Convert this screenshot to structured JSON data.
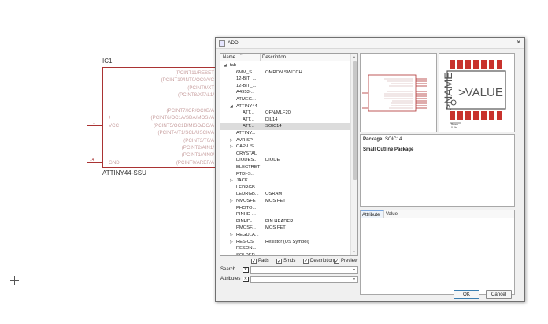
{
  "schematic": {
    "part_name": "IC1",
    "part_value": "ATTINY44-SSU",
    "pin_labels": [
      "(PCINT11/RESET",
      "(PCINT10/INT0/OC0A/C",
      "(PCINT9/XT",
      "(PCINT8/XTAL1/",
      "(PCINT7/ICP/OC0B/A",
      "(PCINT6/OC1A/SDA/MOSI/A",
      "(PCINT5/OC1B/MISO/DO/A",
      "(PCINT4/T1/SCL/USCK/A",
      "(PCINT3/T0/A",
      "(PCINT2/AIN1/",
      "(PCINT1/AIN0/",
      "(PCINT0/AREF/A"
    ],
    "vcc_pin_num": "1",
    "vcc_label": "VCC",
    "gnd_pin_num": "14",
    "gnd_label": "GND",
    "plus_mark": "+"
  },
  "dialog": {
    "title": "ADD",
    "close_glyph": "✕",
    "tree": {
      "col_name": "Name",
      "col_desc": "Description",
      "rows": [
        {
          "exp": "◢",
          "name": "fab",
          "desc": "",
          "indent": 0
        },
        {
          "exp": "",
          "name": "6MM_S...",
          "desc": "OMRON SWITCH",
          "indent": 1
        },
        {
          "exp": "",
          "name": "12-BIT_...",
          "desc": "",
          "indent": 1
        },
        {
          "exp": "",
          "name": "12-BIT_...",
          "desc": "",
          "indent": 1
        },
        {
          "exp": "",
          "name": "A4953-...",
          "desc": "",
          "indent": 1
        },
        {
          "exp": "",
          "name": "ATMEG...",
          "desc": "",
          "indent": 1
        },
        {
          "exp": "◢",
          "name": "ATTINY44",
          "desc": "",
          "indent": 1
        },
        {
          "exp": "",
          "name": "ATT...",
          "desc": "QFN/MLF20",
          "indent": 2
        },
        {
          "exp": "",
          "name": "ATT...",
          "desc": "DIL14",
          "indent": 2
        },
        {
          "exp": "",
          "name": "ATT...",
          "desc": "SOIC14",
          "indent": 2,
          "selected": true
        },
        {
          "exp": "",
          "name": "ATTINY...",
          "desc": "",
          "indent": 1
        },
        {
          "exp": "▷",
          "name": "AVRISP",
          "desc": "",
          "indent": 1
        },
        {
          "exp": "▷",
          "name": "CAP-US",
          "desc": "",
          "indent": 1
        },
        {
          "exp": "",
          "name": "CRYSTAL",
          "desc": "",
          "indent": 1
        },
        {
          "exp": "",
          "name": "DIODES...",
          "desc": "DIODE",
          "indent": 1
        },
        {
          "exp": "",
          "name": "ELECTRET",
          "desc": "",
          "indent": 1
        },
        {
          "exp": "",
          "name": "FTDI-S...",
          "desc": "",
          "indent": 1
        },
        {
          "exp": "▷",
          "name": "JACK",
          "desc": "",
          "indent": 1
        },
        {
          "exp": "",
          "name": "LEDRGB...",
          "desc": "",
          "indent": 1
        },
        {
          "exp": "",
          "name": "LEDRGB...",
          "desc": "OSRAM",
          "indent": 1
        },
        {
          "exp": "▷",
          "name": "NMOSFET",
          "desc": "MOS FET",
          "indent": 1
        },
        {
          "exp": "",
          "name": "PHOTO...",
          "desc": "",
          "indent": 1
        },
        {
          "exp": "",
          "name": "PINHD-...",
          "desc": "",
          "indent": 1
        },
        {
          "exp": "",
          "name": "PINHD-...",
          "desc": "PIN HEADER",
          "indent": 1
        },
        {
          "exp": "",
          "name": "PMOSF...",
          "desc": "MOS FET",
          "indent": 1
        },
        {
          "exp": "▷",
          "name": "REGULA...",
          "desc": "",
          "indent": 1
        },
        {
          "exp": "▷",
          "name": "RES-US",
          "desc": "Resistor (US Symbol)",
          "indent": 1
        },
        {
          "exp": "",
          "name": "RESON...",
          "desc": "",
          "indent": 1
        },
        {
          "exp": "",
          "name": "SOLDER...",
          "desc": "",
          "indent": 1
        }
      ]
    },
    "checkboxes": [
      {
        "label": "Pads",
        "checked": true
      },
      {
        "label": "Smds",
        "checked": true
      },
      {
        "label": "Description",
        "checked": true
      },
      {
        "label": "Preview",
        "checked": true
      }
    ],
    "search_label": "Search",
    "search_value": "",
    "attributes_label": "Attributes",
    "attributes_value": "",
    "package_label": "Package:",
    "package_value": "SOIC14",
    "package_description": "Small Outline Package",
    "attr_col_attribute": "Attribute",
    "attr_col_value": "Value",
    "pkg_preview_name": ">NAME",
    "pkg_preview_value": ">VALUE",
    "pkg_preview_scale": "5mm",
    "pkg_preview_scale_sub": "0.2in",
    "ok_label": "OK",
    "cancel_label": "Cancel",
    "colors": {
      "pad": "#c8322d",
      "outline": "#555555",
      "symbol_red": "#b03030",
      "selection": "#dcdcdc",
      "ok_border": "#3c7fb1"
    }
  }
}
